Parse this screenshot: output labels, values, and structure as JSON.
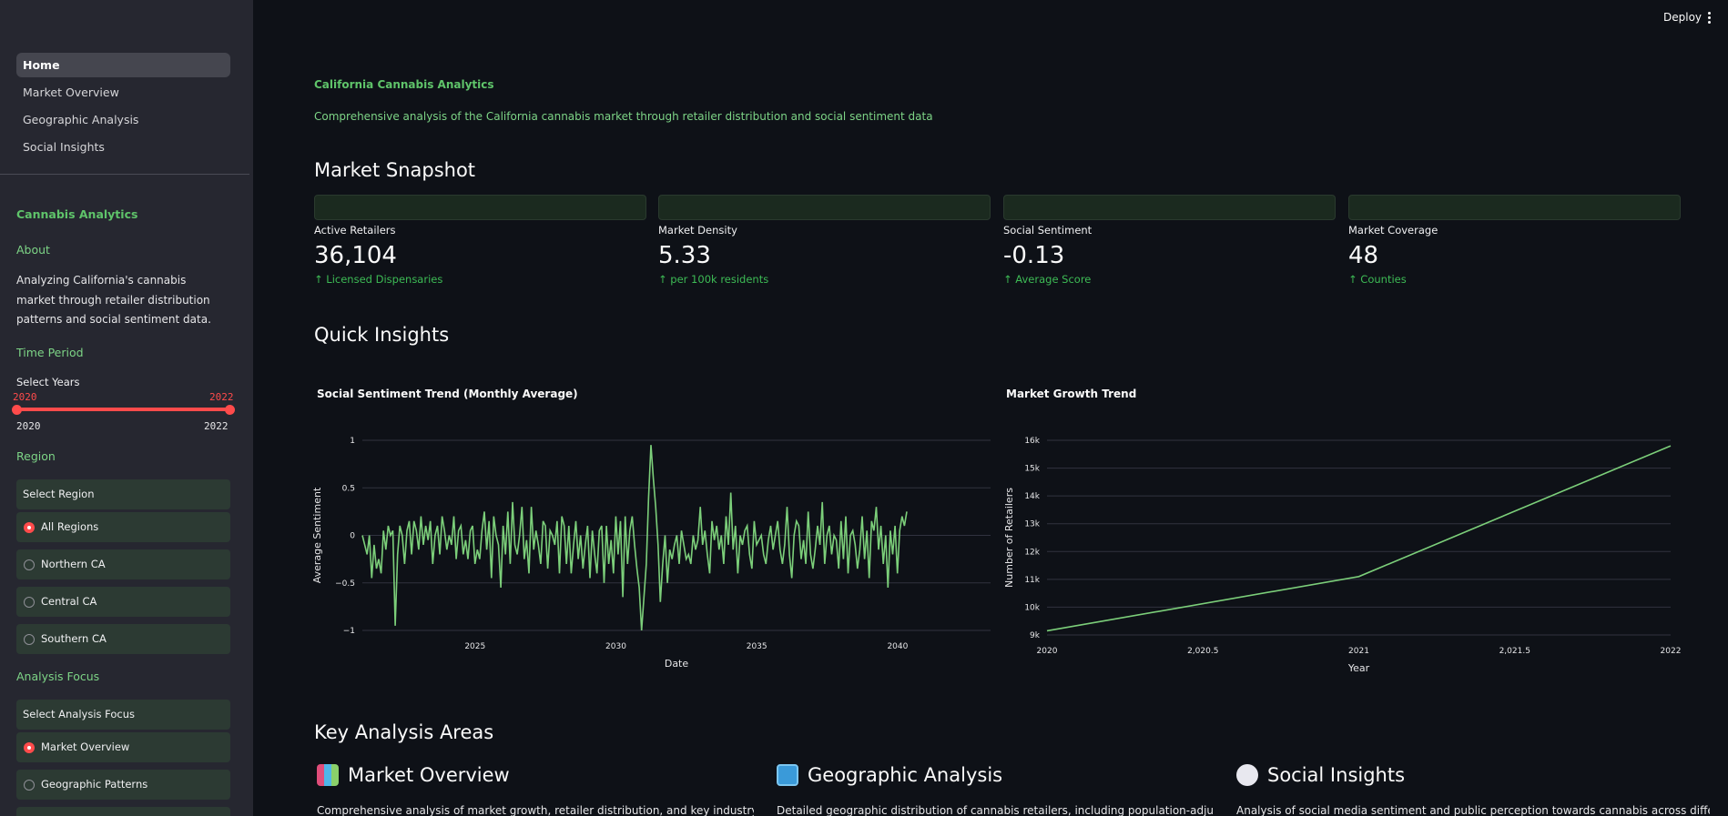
{
  "sidebar": {
    "nav": [
      "Home",
      "Market Overview",
      "Geographic Analysis",
      "Social Insights"
    ],
    "brand": "Cannabis Analytics",
    "about_heading": "About",
    "about_text": "Analyzing California's cannabis market through retailer distribution patterns and social sentiment data.",
    "time_heading": "Time Period",
    "slider_label": "Select Years",
    "slider_min": "2020",
    "slider_max": "2022",
    "slider_low": "2020",
    "slider_high": "2022",
    "region_heading": "Region",
    "region_label": "Select Region",
    "regions": [
      "All Regions",
      "Northern CA",
      "Central CA",
      "Southern CA"
    ],
    "focus_heading": "Analysis Focus",
    "focus_label": "Select Analysis Focus",
    "focus_options": [
      "Market Overview",
      "Geographic Patterns"
    ]
  },
  "topbar": {
    "deploy": "Deploy"
  },
  "main": {
    "title": "California Cannabis Analytics",
    "subtitle": "Comprehensive analysis of the California cannabis market through retailer distribution and social sentiment data",
    "snapshot_heading": "Market Snapshot",
    "metrics": [
      {
        "label": "Active Retailers",
        "value": "36,104",
        "delta": "Licensed Dispensaries"
      },
      {
        "label": "Market Density",
        "value": "5.33",
        "delta": "per 100k residents"
      },
      {
        "label": "Social Sentiment",
        "value": "-0.13",
        "delta": "Average Score"
      },
      {
        "label": "Market Coverage",
        "value": "48",
        "delta": "Counties"
      }
    ],
    "insights_heading": "Quick Insights",
    "areas_heading": "Key Analysis Areas",
    "areas": [
      {
        "title": "Market Overview",
        "icon": "bar-chart-icon",
        "desc": "Comprehensive analysis of market growth, retailer distribution, and key industry metrics"
      },
      {
        "title": "Geographic Analysis",
        "icon": "map-icon",
        "desc": "Detailed geographic distribution of cannabis retailers, including population-adjusted"
      },
      {
        "title": "Social Insights",
        "icon": "thought-bubble-icon",
        "desc": "Analysis of social media sentiment and public perception towards cannabis across different"
      }
    ]
  },
  "colors": {
    "accent_green": "#5fc46a",
    "line_green": "#7ccf7a",
    "slider_red": "#ff4b4b"
  },
  "chart_data": [
    {
      "type": "line",
      "title": "Social Sentiment Trend (Monthly Average)",
      "xlabel": "Date",
      "ylabel": "Average Sentiment",
      "xlim": [
        2021,
        2043.3
      ],
      "ylim": [
        -1,
        1
      ],
      "xticks": [
        2025,
        2030,
        2035,
        2040
      ],
      "xtick_labels": [
        "2025",
        "2030",
        "2035",
        "2040"
      ],
      "yticks": [
        -1,
        -0.5,
        0,
        0.5,
        1
      ],
      "ytick_labels": [
        "−1",
        "−0.5",
        "0",
        "0.5",
        "1"
      ],
      "grid": true,
      "x_start": 2021,
      "x_step": 0.0833,
      "values": [
        0.0,
        -0.1,
        -0.2,
        0.0,
        -0.45,
        -0.1,
        -0.35,
        -0.25,
        -0.4,
        0.05,
        -0.15,
        0.1,
        0.0,
        0.05,
        -0.95,
        -0.2,
        0.1,
        0.0,
        -0.3,
        0.05,
        0.15,
        -0.2,
        0.15,
        0.05,
        -0.15,
        0.2,
        -0.1,
        0.1,
        -0.05,
        0.15,
        -0.3,
        0.0,
        0.1,
        -0.2,
        0.2,
        0.05,
        -0.15,
        0.0,
        -0.1,
        0.2,
        -0.25,
        0.05,
        0.1,
        -0.2,
        -0.05,
        -0.25,
        0.05,
        0.1,
        -0.3,
        -0.15,
        -0.25,
        0.05,
        0.25,
        -0.15,
        0.15,
        -0.45,
        0.2,
        0.0,
        -0.1,
        -0.55,
        0.1,
        -0.2,
        0.25,
        -0.3,
        0.35,
        -0.1,
        -0.2,
        0.0,
        0.3,
        -0.25,
        -0.05,
        -0.4,
        0.3,
        -0.15,
        0.05,
        -0.1,
        -0.3,
        0.15,
        0.1,
        -0.35,
        0.05,
        0.0,
        -0.1,
        0.15,
        -0.4,
        0.2,
        0.1,
        -0.3,
        0.1,
        -0.4,
        -0.1,
        0.15,
        -0.25,
        0.0,
        -0.35,
        -0.1,
        0.1,
        -0.45,
        0.05,
        -0.2,
        -0.4,
        0.05,
        0.1,
        -0.5,
        0.1,
        -0.3,
        -0.05,
        -0.4,
        0.2,
        -0.2,
        0.15,
        -0.65,
        0.2,
        -0.3,
        0.05,
        0.2,
        -0.1,
        -0.35,
        -0.55,
        -1.0,
        -0.65,
        -0.3,
        0.4,
        0.95,
        0.6,
        0.3,
        -0.1,
        -0.7,
        -0.3,
        0.0,
        -0.5,
        -0.15,
        -0.25,
        -0.1,
        0.0,
        -0.3,
        0.05,
        -0.1,
        -0.25,
        -0.2,
        -0.3,
        0.0,
        -0.15,
        -0.05,
        0.3,
        -0.1,
        0.05,
        -0.2,
        -0.4,
        0.15,
        -0.05,
        0.1,
        -0.15,
        0.0,
        -0.3,
        0.2,
        -0.1,
        0.45,
        -0.15,
        0.1,
        -0.4,
        0.0,
        -0.1,
        0.05,
        0.1,
        -0.2,
        -0.35,
        0.15,
        -0.1,
        -0.05,
        0.0,
        -0.2,
        -0.3,
        -0.05,
        0.1,
        -0.15,
        0.0,
        0.15,
        -0.15,
        -0.3,
        -0.1,
        0.3,
        -0.2,
        -0.45,
        0.0,
        0.15,
        0.1,
        -0.25,
        -0.05,
        -0.3,
        0.25,
        -0.2,
        -0.35,
        -0.15,
        0.1,
        -0.1,
        0.35,
        -0.3,
        0.0,
        0.1,
        -0.2,
        0.0,
        -0.05,
        -0.35,
        0.15,
        -0.25,
        0.2,
        -0.4,
        0.0,
        0.05,
        -0.1,
        -0.35,
        -0.15,
        0.2,
        -0.25,
        0.05,
        -0.45,
        0.15,
        0.05,
        0.3,
        -0.15,
        0.1,
        -0.3,
        0.0,
        -0.55,
        0.05,
        -0.2,
        0.1,
        -0.4,
        0.05,
        0.2,
        0.1,
        0.25
      ]
    },
    {
      "type": "line",
      "title": "Market Growth Trend",
      "xlabel": "Year",
      "ylabel": "Number of Retailers",
      "xlim": [
        2020,
        2022
      ],
      "ylim": [
        9000,
        16000
      ],
      "xticks": [
        2020,
        2020.5,
        2021,
        2021.5,
        2022
      ],
      "xtick_labels": [
        "2020",
        "2,020.5",
        "2021",
        "2,021.5",
        "2022"
      ],
      "yticks": [
        9000,
        10000,
        11000,
        12000,
        13000,
        14000,
        15000,
        16000
      ],
      "ytick_labels": [
        "9k",
        "10k",
        "11k",
        "12k",
        "13k",
        "14k",
        "15k",
        "16k"
      ],
      "grid": true,
      "x": [
        2020,
        2021,
        2022
      ],
      "values": [
        9150,
        11100,
        15800
      ]
    }
  ]
}
